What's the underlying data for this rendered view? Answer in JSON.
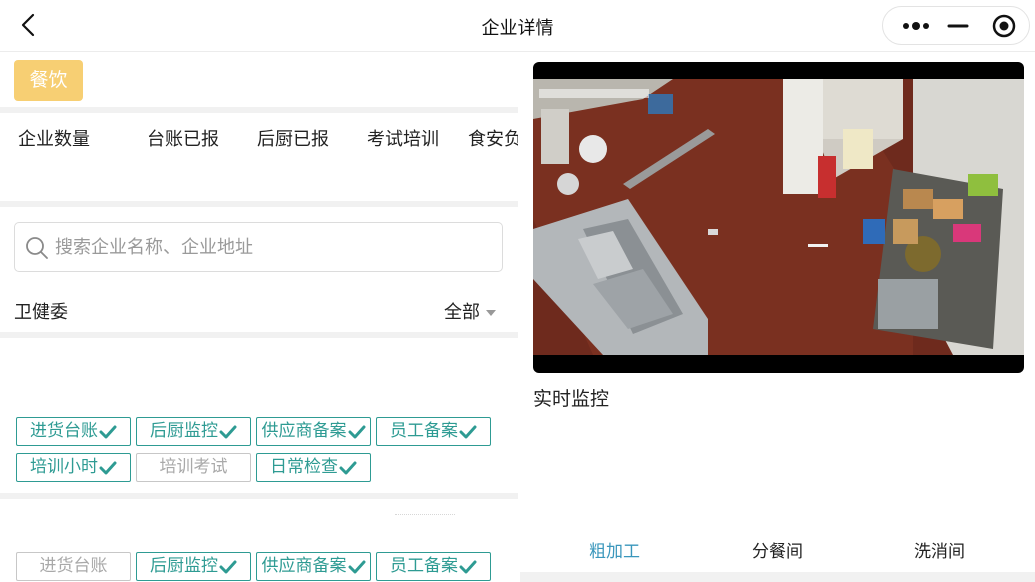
{
  "nav": {
    "title": "企业详情",
    "back_icon": "chevron-left-icon",
    "more_icon": "more-dots-icon",
    "min_icon": "minimize-icon",
    "close_icon": "target-circle-icon"
  },
  "category_tag": {
    "label": "餐饮",
    "color": "#f7cf73"
  },
  "stats_tabs": [
    "企业数量",
    "台账已报",
    "后厨已报",
    "考试培训",
    "食安负"
  ],
  "search": {
    "placeholder": "搜索企业名称、企业地址",
    "value": "",
    "icon": "search-icon"
  },
  "filter": {
    "left_label": "卫健委",
    "right_label": "全部"
  },
  "colors": {
    "accent": "#2e9b93",
    "inactive": "#a9a9a9",
    "tab_active": "#3a97bc"
  },
  "enterprise_cards": [
    {
      "tags": [
        {
          "label": "进货台账",
          "checked": true
        },
        {
          "label": "后厨监控",
          "checked": true
        },
        {
          "label": "供应商备案",
          "checked": true
        },
        {
          "label": "员工备案",
          "checked": true
        },
        {
          "label": "培训小时",
          "checked": true
        },
        {
          "label": "培训考试",
          "checked": false
        },
        {
          "label": "日常检查",
          "checked": true
        }
      ]
    },
    {
      "tags": [
        {
          "label": "进货台账",
          "checked": false
        },
        {
          "label": "后厨监控",
          "checked": true
        },
        {
          "label": "供应商备案",
          "checked": true
        },
        {
          "label": "员工备案",
          "checked": true
        }
      ]
    }
  ],
  "video": {
    "label": "实时监控"
  },
  "room_tabs": [
    {
      "label": "粗加工",
      "active": true
    },
    {
      "label": "分餐间",
      "active": false
    },
    {
      "label": "洗消间",
      "active": false
    }
  ]
}
